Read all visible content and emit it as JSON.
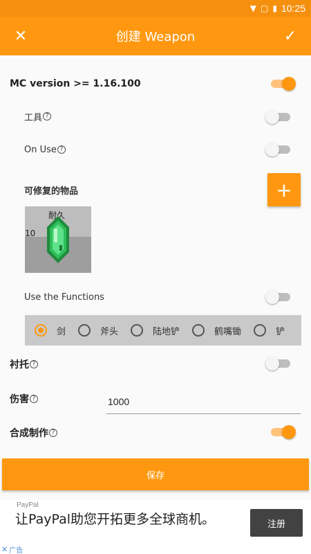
{
  "status_bar": {
    "time": "10:25"
  },
  "app_bar": {
    "title": "创建 Weapon",
    "close_glyph": "✕",
    "confirm_glyph": "✓"
  },
  "settings": {
    "mc_version": {
      "label": "MC version >= 1.16.100",
      "enabled": true
    },
    "tool": {
      "label": "工具",
      "enabled": false
    },
    "on_use": {
      "label": "On Use",
      "enabled": false
    },
    "repairable_items": {
      "label": "可修复的物品",
      "add_glyph": "+"
    },
    "item": {
      "durability_label": "耐久",
      "count": "10"
    },
    "use_functions": {
      "label": "Use the Functions",
      "enabled": false
    },
    "tool_types": [
      {
        "label": "剑",
        "checked": true
      },
      {
        "label": "斧头",
        "checked": false
      },
      {
        "label": "陆地铲",
        "checked": false
      },
      {
        "label": "鹤嘴锄",
        "checked": false
      },
      {
        "label": "铲",
        "checked": false
      }
    ],
    "padding": {
      "label": "衬托",
      "enabled": false
    },
    "damage": {
      "label": "伤害",
      "value": "1000"
    },
    "crafting": {
      "label": "合成制作",
      "enabled": true
    }
  },
  "help_glyph": "?",
  "save_label": "保存",
  "ad": {
    "brand": "PayPal",
    "headline": "让PayPal助您开拓更多全球商机。",
    "cta": "注册",
    "tag": "广告"
  },
  "colors": {
    "accent": "#ff9810",
    "accent_dark": "#f5900f",
    "radio_bar": "#c9c9c9"
  }
}
